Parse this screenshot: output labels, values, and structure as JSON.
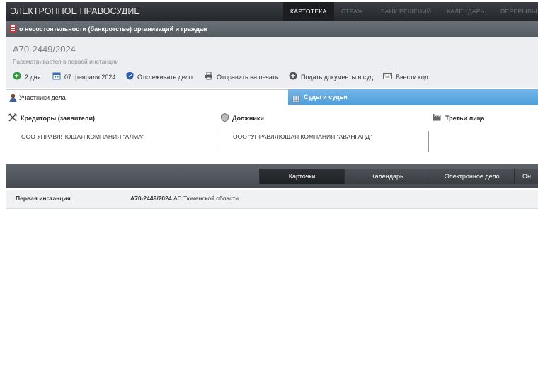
{
  "header": {
    "brand": "ЭЛЕКТРОННОЕ ПРАВОСУДИЕ",
    "nav": [
      "КАРТОТЕКА",
      "СТРАЖ",
      "БАНК РЕШЕНИЙ",
      "КАЛЕНДАРЬ",
      "ПЕРЕРЫВЫ"
    ],
    "active_nav": "КАРТОТЕКА"
  },
  "category": {
    "text": "о несостоятельности (банкротстве) организаций и граждан"
  },
  "case": {
    "number": "А70-2449/2024",
    "status": "Рассматривается в первой инстанции",
    "actions": {
      "days": "2 дня",
      "date": "07 февраля 2024",
      "track": "Отслеживать дело",
      "print": "Отправить на печать",
      "submit": "Подать документы в суд",
      "code": "Ввести код"
    }
  },
  "tabs": {
    "participants": "Участники дела",
    "courts": "Суды и судьи"
  },
  "groups": {
    "creditors": {
      "title": "Кредиторы (заявители)",
      "value": "ООО УПРАВЛЯЮЩАЯ КОМПАНИЯ \"АЛМА\""
    },
    "debtors": {
      "title": "Должники",
      "value": "ООО \"УПРАВЛЯЮЩАЯ КОМПАНИЯ \"АВАНГАРД\""
    },
    "third": {
      "title": "Третьи лица"
    }
  },
  "bottom_tabs": [
    "Карточки",
    "Календарь",
    "Электронное дело",
    "Он"
  ],
  "instance": {
    "label": "Первая инстанция",
    "case_number": "А70-2449/2024",
    "court": " АС Тюменской области"
  },
  "colors": {
    "accent_blue": "#4f9fdb",
    "topbar": "#2a2d31"
  }
}
